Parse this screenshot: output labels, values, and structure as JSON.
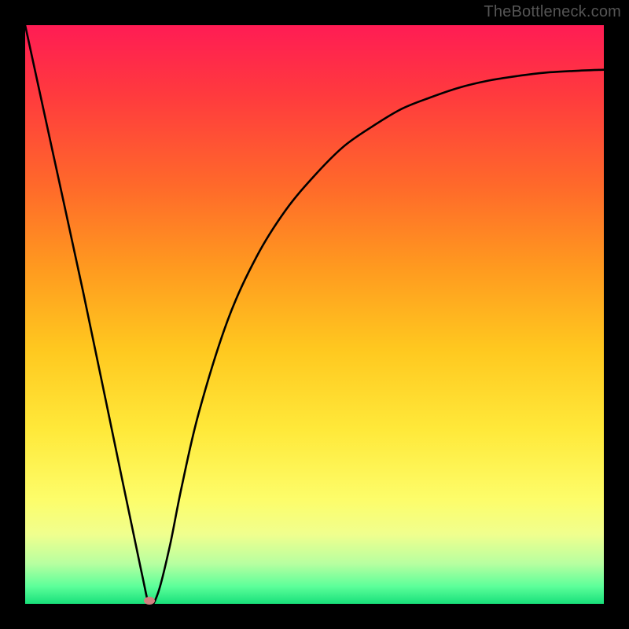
{
  "watermark": "TheBottleneck.com",
  "chart_data": {
    "type": "line",
    "title": "",
    "xlabel": "",
    "ylabel": "",
    "xlim": [
      0,
      1
    ],
    "ylim": [
      0,
      1
    ],
    "grid": false,
    "legend": false,
    "series": [
      {
        "name": "curve",
        "x": [
          0.0,
          0.05,
          0.1,
          0.15,
          0.2,
          0.215,
          0.23,
          0.25,
          0.27,
          0.3,
          0.35,
          0.4,
          0.45,
          0.5,
          0.55,
          0.6,
          0.65,
          0.7,
          0.75,
          0.8,
          0.85,
          0.9,
          0.95,
          1.0
        ],
        "y": [
          1.0,
          0.77,
          0.54,
          0.3,
          0.06,
          0.0,
          0.02,
          0.1,
          0.2,
          0.33,
          0.49,
          0.6,
          0.68,
          0.74,
          0.79,
          0.825,
          0.855,
          0.875,
          0.892,
          0.904,
          0.912,
          0.918,
          0.921,
          0.923
        ]
      }
    ],
    "marker": {
      "x": 0.215,
      "y": 0.0,
      "color": "#d28080"
    },
    "background_gradient": {
      "top": "#ff1c54",
      "bottom": "#18e07a"
    }
  }
}
